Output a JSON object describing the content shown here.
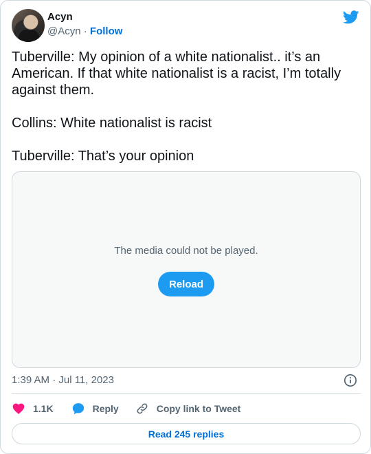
{
  "author": {
    "name": "Acyn",
    "handle": "@Acyn",
    "separator": "·",
    "follow_label": "Follow"
  },
  "tweet": {
    "text": "Tuberville: My opinion of a white nationalist.. it’s an American. If that white nationalist is a racist, I’m totally against them.\n\nCollins: White nationalist is racist\n\nTuberville: That’s your opinion",
    "timestamp": "1:39 AM · Jul 11, 2023"
  },
  "media": {
    "message": "The media could not be played.",
    "reload_label": "Reload"
  },
  "actions": {
    "like_count": "1.1K",
    "reply_label": "Reply",
    "copy_label": "Copy link to Tweet"
  },
  "replies": {
    "label": "Read 245 replies"
  },
  "icons": {
    "brand": "twitter-bird-icon",
    "info": "info-icon",
    "like": "heart-icon",
    "reply": "reply-bubble-icon",
    "copy": "link-icon"
  },
  "colors": {
    "accent": "#1d9bf0",
    "link": "#006fd6",
    "like": "#f91880",
    "muted": "#536471",
    "text": "#0f1419",
    "border": "#cfd9de"
  }
}
